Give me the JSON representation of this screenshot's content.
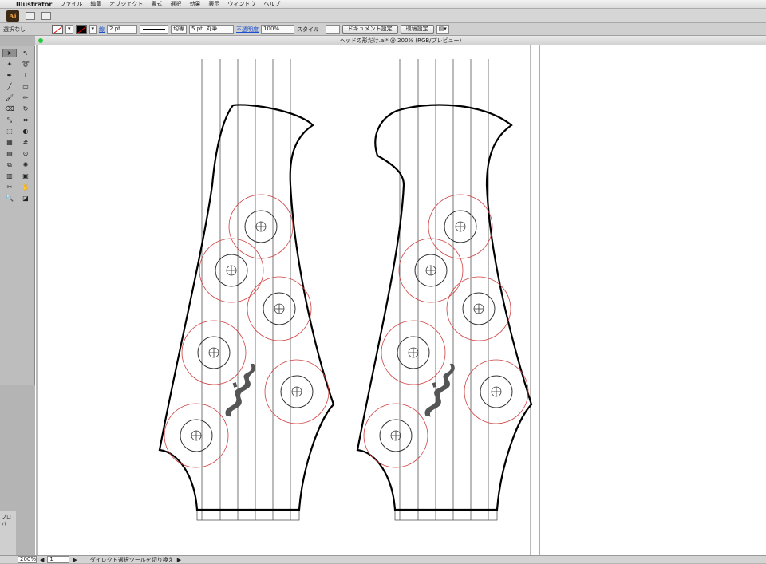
{
  "menubar": {
    "app_name": "Illustrator",
    "items": [
      "ファイル",
      "編集",
      "オブジェクト",
      "書式",
      "選択",
      "効果",
      "表示",
      "ウィンドウ",
      "ヘルプ"
    ]
  },
  "appbar": {
    "logo": "Ai"
  },
  "control_bar": {
    "selection_label": "選択なし",
    "stroke_weight": "2 pt",
    "stroke_profile": "均等",
    "brush": "5 pt. 丸筆",
    "opacity_label": "不透明度",
    "opacity_value": "100%",
    "style_label": "スタイル :",
    "document_setup_button": "ドキュメント設定",
    "preferences_button": "環境設定"
  },
  "document": {
    "title": "ヘッドの形だけ.ai* @ 200% (RGB/プレビュー)"
  },
  "left_panel": {
    "label": "プロパ"
  },
  "status": {
    "zoom": "200%",
    "artboard": "1",
    "message": "ダイレクト選択ツールを切り換え"
  },
  "colors": {
    "guide_red": "#e02020",
    "tuner_ring": "#d04040",
    "outline": "#000000",
    "logo_gray": "#555555",
    "opacity_link": "#1a4fd0"
  },
  "icons": {
    "tools": [
      "selection-icon",
      "direct-selection-icon",
      "magic-wand-icon",
      "lasso-icon",
      "pen-icon",
      "type-icon",
      "line-icon",
      "rectangle-icon",
      "paintbrush-icon",
      "pencil-icon",
      "eraser-icon",
      "rotate-icon",
      "scale-icon",
      "width-icon",
      "free-transform-icon",
      "shape-builder-icon",
      "perspective-icon",
      "mesh-icon",
      "gradient-icon",
      "eyedropper-icon",
      "blend-icon",
      "symbol-sprayer-icon",
      "graph-icon",
      "artboard-icon",
      "slice-icon",
      "hand-icon",
      "zoom-icon",
      "fill-stroke-icon"
    ]
  }
}
